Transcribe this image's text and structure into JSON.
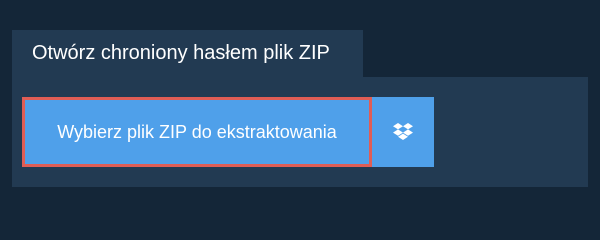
{
  "tab": {
    "title": "Otwórz chroniony hasłem plik ZIP"
  },
  "actions": {
    "choose_file_label": "Wybierz plik ZIP do ekstraktowania",
    "dropbox_icon": "dropbox-icon"
  },
  "colors": {
    "page_background": "#142638",
    "panel_background": "#223a52",
    "button_background": "#4fa0ea",
    "highlight_border": "#e05d55"
  }
}
